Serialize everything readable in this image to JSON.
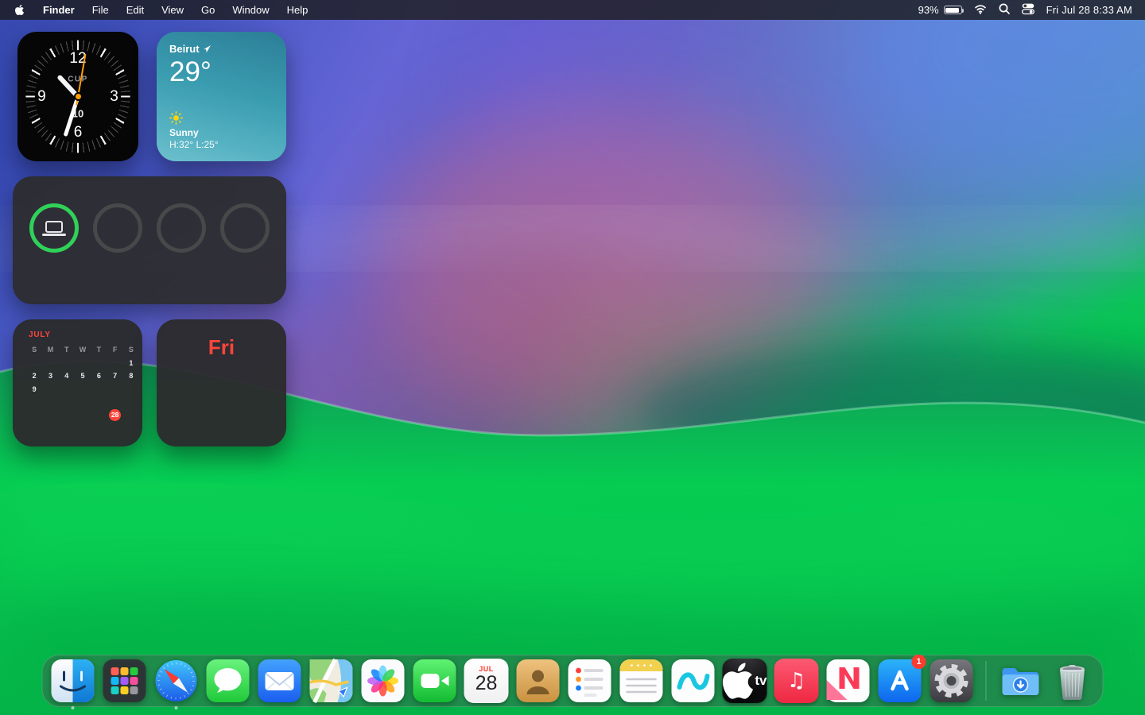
{
  "menu_bar": {
    "app_name": "Finder",
    "menus": [
      "File",
      "Edit",
      "View",
      "Go",
      "Window",
      "Help"
    ],
    "status": {
      "battery_percent": "93%",
      "datetime": "Fri Jul 28  8:33 AM"
    }
  },
  "widgets": {
    "clock": {
      "dial": [
        "12",
        "3",
        "6",
        "9"
      ],
      "city": "CUP",
      "date": "10"
    },
    "weather": {
      "location": "Beirut",
      "temperature": "29°",
      "condition": "Sunny",
      "high_low": "H:32° L:25°"
    },
    "battery_rings": {
      "rings": [
        {
          "device": "laptop",
          "state": "charged"
        },
        {
          "state": "empty"
        },
        {
          "state": "empty"
        },
        {
          "state": "empty"
        }
      ]
    },
    "calendar_month": {
      "month_label": "JULY",
      "day_headers": [
        "S",
        "M",
        "T",
        "W",
        "T",
        "F",
        "S"
      ],
      "weeks": [
        [
          "",
          "",
          "",
          "",
          "",
          "",
          "1"
        ],
        [
          "2",
          "3",
          "4",
          "5",
          "6",
          "7",
          "8"
        ],
        [
          "9",
          "",
          "",
          "",
          "",
          "",
          ""
        ],
        [
          "",
          "",
          "",
          "",
          "",
          "",
          ""
        ],
        [
          "",
          "",
          "",
          "",
          "",
          "28",
          ""
        ]
      ],
      "today": "28"
    },
    "calendar_day": {
      "weekday": "Fri"
    }
  },
  "dock": {
    "app_names": [
      "Finder",
      "Launchpad",
      "Safari",
      "Messages",
      "Mail",
      "Maps",
      "Photos",
      "FaceTime",
      "Calendar",
      "Contacts",
      "Reminders",
      "Notes",
      "Freeform",
      "TV",
      "Music",
      "News",
      "App Store",
      "System Settings",
      "Downloads",
      "Trash"
    ],
    "running_apps": [
      "Finder",
      "Safari"
    ],
    "calendar_icon": {
      "month": "JUL",
      "day": "28"
    },
    "appletv_label": "tv",
    "app_store_badge": "1",
    "music_glyph": "♫"
  }
}
